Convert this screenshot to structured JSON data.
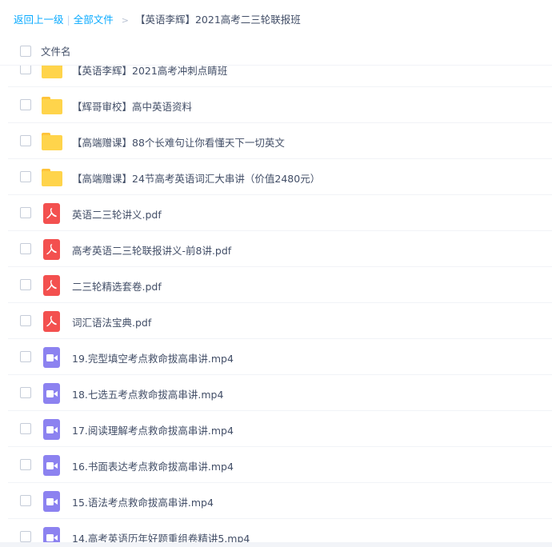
{
  "breadcrumb": {
    "back": "返回上一级",
    "separator": "|",
    "all_files": "全部文件",
    "arrow": ">",
    "current": "【英语李辉】2021高考二三轮联报班"
  },
  "header": {
    "column_name": "文件名"
  },
  "files": [
    {
      "type": "folder",
      "icon": "folder-icon",
      "name": "【英语李辉】2021高考冲刺点睛班"
    },
    {
      "type": "folder",
      "icon": "folder-icon",
      "name": "【辉哥审校】高中英语资料"
    },
    {
      "type": "folder",
      "icon": "folder-icon",
      "name": "【高端赠课】88个长难句让你看懂天下一切英文"
    },
    {
      "type": "folder",
      "icon": "folder-icon",
      "name": "【高端赠课】24节高考英语词汇大串讲（价值2480元）"
    },
    {
      "type": "pdf",
      "icon": "pdf-icon",
      "name": "英语二三轮讲义.pdf"
    },
    {
      "type": "pdf",
      "icon": "pdf-icon",
      "name": "高考英语二三轮联报讲义-前8讲.pdf"
    },
    {
      "type": "pdf",
      "icon": "pdf-icon",
      "name": "二三轮精选套卷.pdf"
    },
    {
      "type": "pdf",
      "icon": "pdf-icon",
      "name": "词汇语法宝典.pdf"
    },
    {
      "type": "video",
      "icon": "video-icon",
      "name": "19.完型填空考点救命拔高串讲.mp4"
    },
    {
      "type": "video",
      "icon": "video-icon",
      "name": "18.七选五考点救命拔高串讲.mp4"
    },
    {
      "type": "video",
      "icon": "video-icon",
      "name": "17.阅读理解考点救命拔高串讲.mp4"
    },
    {
      "type": "video",
      "icon": "video-icon",
      "name": "16.书面表达考点救命拔高串讲.mp4"
    },
    {
      "type": "video",
      "icon": "video-icon",
      "name": "15.语法考点救命拔高串讲.mp4"
    },
    {
      "type": "video",
      "icon": "video-icon",
      "name": "14.高考英语历年好题重组卷精讲5.mp4"
    }
  ],
  "colors": {
    "link": "#09aaff",
    "text": "#424e67",
    "folder": "#ffd44b",
    "pdf": "#f3504f",
    "video": "#8c82f0"
  }
}
